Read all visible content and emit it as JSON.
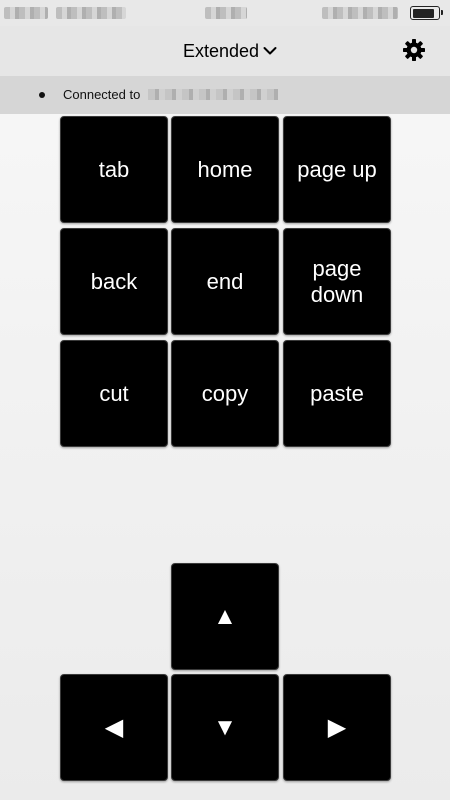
{
  "header": {
    "mode_title": "Extended"
  },
  "connection": {
    "label": "Connected to"
  },
  "keys": [
    {
      "label": "tab"
    },
    {
      "label": "home"
    },
    {
      "label": "page up"
    },
    {
      "label": "back"
    },
    {
      "label": "end"
    },
    {
      "label": "page down"
    },
    {
      "label": "cut"
    },
    {
      "label": "copy"
    },
    {
      "label": "paste"
    }
  ],
  "arrows": {
    "up": "▲",
    "left": "◀",
    "down": "▼",
    "right": "▶"
  },
  "icons": {
    "settings": "gear-icon",
    "mode_dropdown": "chevron-down-icon"
  },
  "colors": {
    "key_background": "#000000",
    "key_text": "#ffffff",
    "nav_background": "#e6e6e6",
    "connection_background": "#d6d6d6"
  }
}
